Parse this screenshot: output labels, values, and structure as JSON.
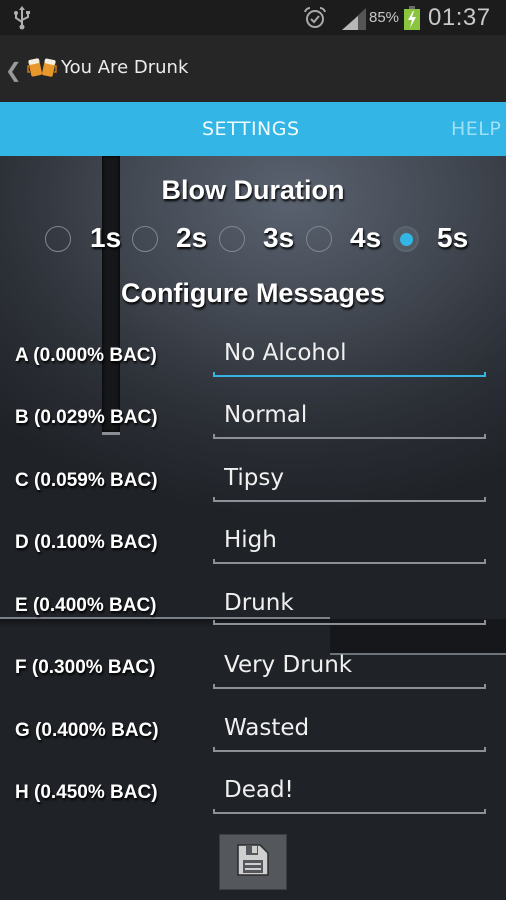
{
  "status_bar": {
    "usb_icon": "usb-icon",
    "alarm_icon": "alarm-icon",
    "signal_icon": "signal-icon",
    "battery_percent": "85%",
    "battery_icon": "battery-charging-icon",
    "time": "01:37"
  },
  "action_bar": {
    "back_glyph": "❮",
    "logo_icon": "beer-mugs-icon",
    "title": "You Are Drunk"
  },
  "tabs": [
    {
      "label": "SETTINGS",
      "selected": true
    },
    {
      "label": "HELP",
      "selected": false
    }
  ],
  "blow_duration": {
    "heading": "Blow Duration",
    "options": [
      {
        "label": "1s",
        "checked": false
      },
      {
        "label": "2s",
        "checked": false
      },
      {
        "label": "3s",
        "checked": false
      },
      {
        "label": "4s",
        "checked": false
      },
      {
        "label": "5s",
        "checked": true
      }
    ]
  },
  "configure_messages": {
    "heading": "Configure Messages",
    "rows": [
      {
        "label": "A (0.000% BAC)",
        "value": "No Alcohol",
        "focused": true
      },
      {
        "label": "B (0.029% BAC)",
        "value": "Normal",
        "focused": false
      },
      {
        "label": "C (0.059% BAC)",
        "value": "Tipsy",
        "focused": false
      },
      {
        "label": "D (0.100% BAC)",
        "value": "High",
        "focused": false
      },
      {
        "label": "E (0.400% BAC)",
        "value": "Drunk",
        "focused": false
      },
      {
        "label": "F (0.300% BAC)",
        "value": "Very Drunk",
        "focused": false
      },
      {
        "label": "G (0.400% BAC)",
        "value": "Wasted",
        "focused": false
      },
      {
        "label": "H (0.450% BAC)",
        "value": "Dead!",
        "focused": false
      }
    ]
  },
  "save_button": {
    "icon": "floppy-disk-icon"
  },
  "colors": {
    "accent": "#33b5e5",
    "action_bar": "#262626",
    "status_bar": "#1c1c1c",
    "battery": "#8bc53f"
  }
}
